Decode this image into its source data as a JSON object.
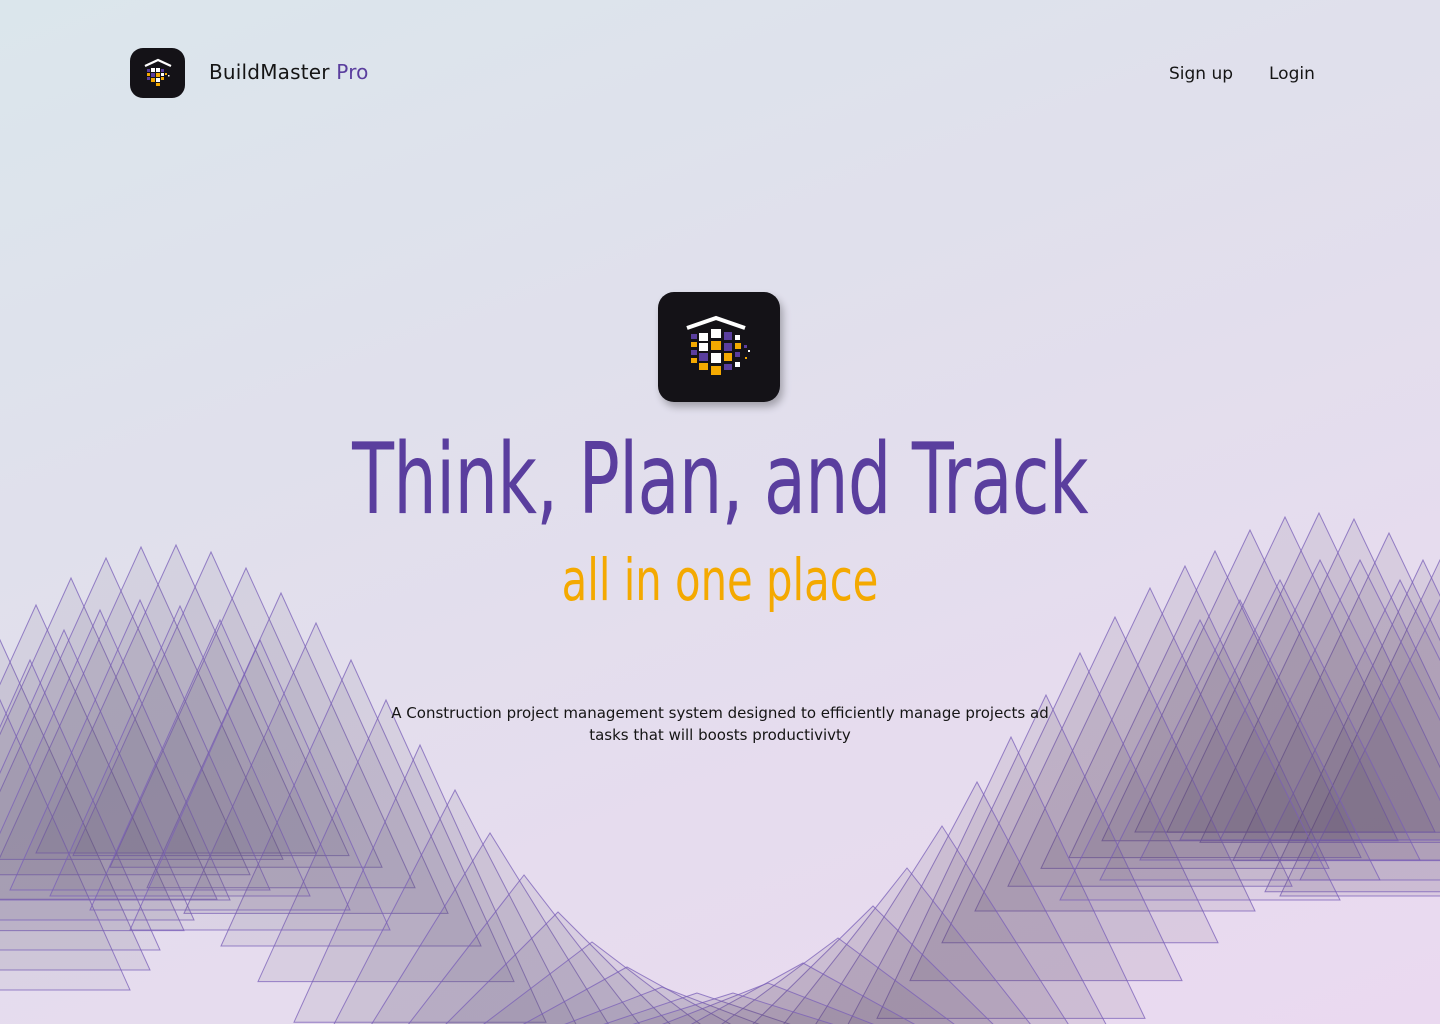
{
  "header": {
    "brand_name": "BuildMaster",
    "brand_suffix": "Pro",
    "signup_label": "Sign up",
    "login_label": "Login"
  },
  "hero": {
    "headline": "Think, Plan, and Track",
    "subheadline": "all in one place",
    "description": "A Construction project management system designed to efficiently manage projects ad tasks that will boosts productivivty"
  },
  "colors": {
    "primary_purple": "#5a3e9e",
    "accent_orange": "#f4a900",
    "logo_bg": "#141217"
  },
  "icons": {
    "nav_logo": "building-blocks-logo-icon",
    "hero_logo": "building-blocks-logo-icon"
  }
}
